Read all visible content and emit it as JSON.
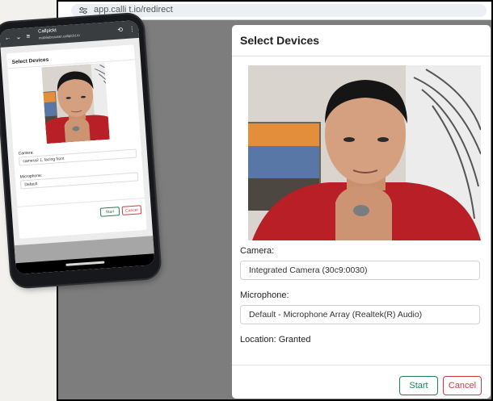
{
  "desktop": {
    "url": "app.calli    t.io/redirect",
    "modal": {
      "title": "Select Devices",
      "camera_label": "Camera:",
      "camera_value": "Integrated Camera (30c9:0030)",
      "microphone_label": "Microphone:",
      "microphone_value": "Default - Microphone Array (Realtek(R) Audio)",
      "location_status": "Location: Granted",
      "start_label": "Start",
      "cancel_label": "Cancel"
    }
  },
  "phone": {
    "tab_title": "Callpickt",
    "url": "mobilebrowser.callpickt.io",
    "modal": {
      "title": "Select Devices",
      "camera_label": "Camera:",
      "camera_value": "camera2 1, facing front",
      "microphone_label": "Microphone:",
      "microphone_value": "Default",
      "start_label": "Start",
      "cancel_label": "Cancel"
    }
  },
  "colors": {
    "start_accent": "#198754",
    "cancel_accent": "#dc3545",
    "overlay_gray": "#7d7d7d"
  }
}
